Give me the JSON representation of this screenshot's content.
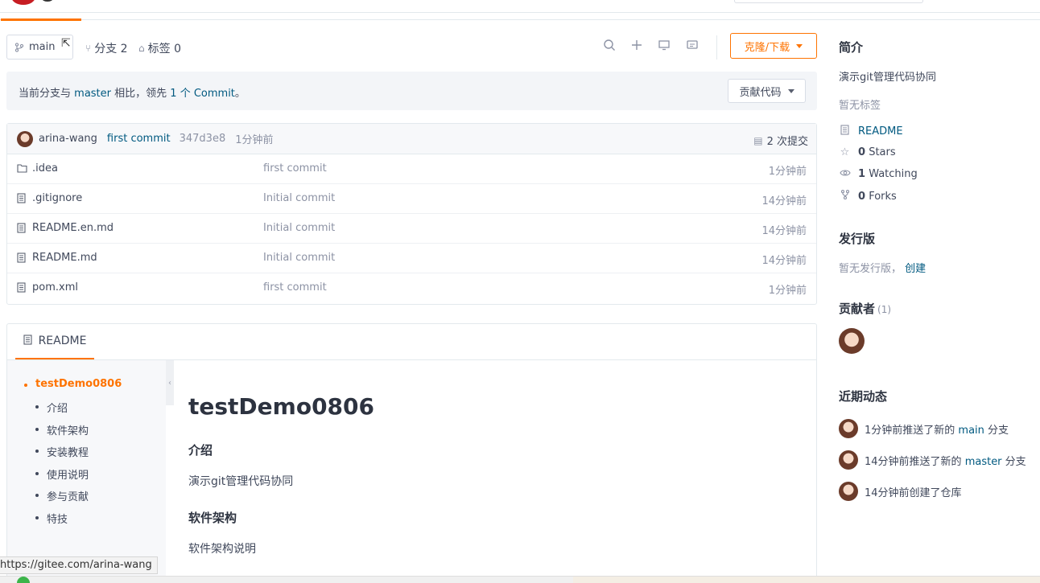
{
  "toolbar": {
    "branch": "main",
    "branches_label": "分支 2",
    "tags_label": "标签 0",
    "clone_label": "克隆/下载"
  },
  "compare": {
    "prefix": "当前分支与",
    "base_branch": "master",
    "middle": "相比，领先",
    "ahead_link": "1 个 Commit",
    "suffix": "。",
    "contribute_label": "贡献代码"
  },
  "last_commit": {
    "author": "arina-wang",
    "message": "first commit",
    "sha": "347d3e8",
    "time": "1分钟前",
    "commit_count": "2 次提交"
  },
  "files": [
    {
      "name": ".idea",
      "type": "folder",
      "message": "first commit",
      "time": "1分钟前"
    },
    {
      "name": ".gitignore",
      "type": "file",
      "message": "Initial commit",
      "time": "14分钟前"
    },
    {
      "name": "README.en.md",
      "type": "file",
      "message": "Initial commit",
      "time": "14分钟前"
    },
    {
      "name": "README.md",
      "type": "file",
      "message": "Initial commit",
      "time": "14分钟前"
    },
    {
      "name": "pom.xml",
      "type": "file",
      "message": "first commit",
      "time": "1分钟前"
    }
  ],
  "readme": {
    "tab_label": "README",
    "toc": [
      "testDemo0806",
      "介绍",
      "软件架构",
      "安装教程",
      "使用说明",
      "参与贡献",
      "特技"
    ],
    "title": "testDemo0806",
    "h_intro": "介绍",
    "intro_text": "演示git管理代码协同",
    "h_arch": "软件架构",
    "arch_text": "软件架构说明"
  },
  "sidebar": {
    "about_heading": "简介",
    "description": "演示git管理代码协同",
    "no_tags": "暂无标签",
    "readme_link": "README",
    "stars_num": "0",
    "stars_label": "Stars",
    "watching_num": "1",
    "watching_label": "Watching",
    "forks_num": "0",
    "forks_label": "Forks",
    "release_heading": "发行版",
    "no_release": "暂无发行版，",
    "create_link": "创建",
    "contributors_heading": "贡献者",
    "contributors_count": "(1)",
    "activity_heading": "近期动态",
    "activity": [
      {
        "prefix": "1分钟前推送了新的",
        "branch": "main",
        "suffix": "分支"
      },
      {
        "prefix": "14分钟前推送了新的",
        "branch": "master",
        "suffix": "分支"
      },
      {
        "prefix": "14分钟前创建了仓库",
        "branch": "",
        "suffix": ""
      }
    ]
  },
  "status_bar": {
    "url": "https://gitee.com/arina-wang"
  },
  "colors": {
    "accent": "#fe7300",
    "link": "#005980",
    "muted": "#8c92a4"
  }
}
